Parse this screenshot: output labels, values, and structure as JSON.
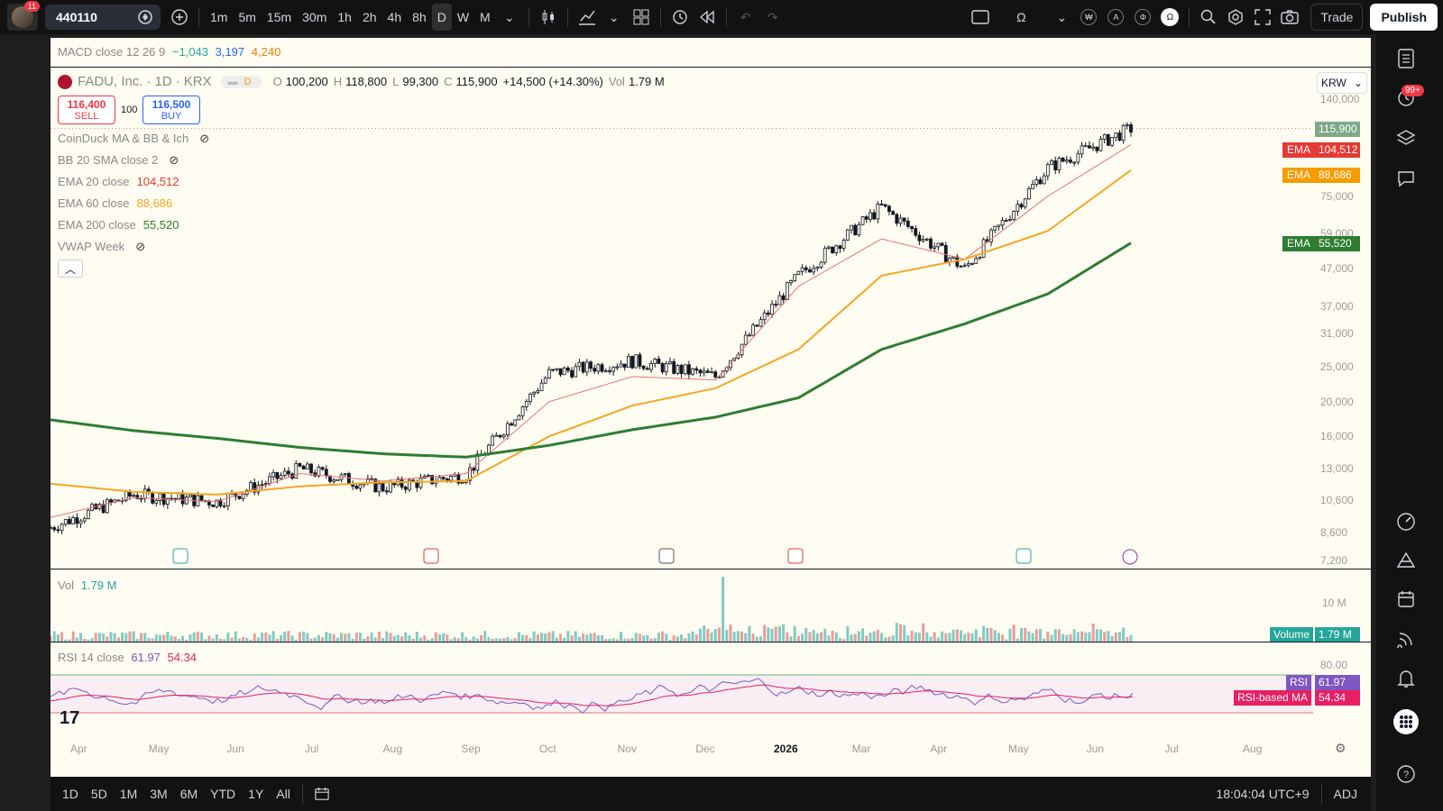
{
  "topbar": {
    "avatar_badge": "11",
    "symbol": "440110",
    "intervals": [
      "1m",
      "5m",
      "15m",
      "30m",
      "1h",
      "2h",
      "4h",
      "8h",
      "D",
      "W",
      "M"
    ],
    "active_interval": "D",
    "trade_label": "Trade",
    "publish_label": "Publish"
  },
  "macd": {
    "label": "MACD close 12 26 9",
    "v1": "−1,043",
    "v2": "3,197",
    "v3": "4,240"
  },
  "symbol_info": {
    "name": "FADU, Inc.",
    "interval": "1D",
    "exchange": "KRX",
    "flag": "D",
    "open_label": "O",
    "open": "100,200",
    "high_label": "H",
    "high": "118,800",
    "low_label": "L",
    "low": "99,300",
    "close_label": "C",
    "close": "115,900",
    "change": "+14,500 (+14.30%)",
    "vol_label": "Vol",
    "vol": "1.79 M"
  },
  "order": {
    "sell_price": "116,400",
    "sell_label": "SELL",
    "qty": "100",
    "buy_price": "116,500",
    "buy_label": "BUY"
  },
  "currency": "KRW",
  "indicators": [
    {
      "label": "CoinDuck MA & BB & Ich",
      "value": "",
      "color": "#888888",
      "hidden": true
    },
    {
      "label": "BB 20 SMA close 2",
      "value": "",
      "color": "#888888",
      "hidden": true
    },
    {
      "label": "EMA 20 close",
      "value": "104,512",
      "color": "#e53935",
      "hidden": false
    },
    {
      "label": "EMA 60 close",
      "value": "88,686",
      "color": "#f5a623",
      "hidden": false
    },
    {
      "label": "EMA 200 close",
      "value": "55,520",
      "color": "#2e7d32",
      "hidden": false
    },
    {
      "label": "VWAP Week",
      "value": "",
      "color": "#888888",
      "hidden": true
    }
  ],
  "price_axis": [
    "140,000",
    "75,000",
    "59,000",
    "47,000",
    "37,000",
    "31,000",
    "25,000",
    "20,000",
    "16,000",
    "13,000",
    "10,600",
    "8,600",
    "7,200"
  ],
  "price_tags": [
    {
      "label": "",
      "value": "115,900",
      "color": "#7fa88a"
    },
    {
      "label": "EMA",
      "value": "104,512",
      "color": "#e53935"
    },
    {
      "label": "EMA",
      "value": "88,686",
      "color": "#f59d00"
    },
    {
      "label": "EMA",
      "value": "55,520",
      "color": "#2e7d32"
    }
  ],
  "volume": {
    "label": "Vol",
    "value": "1.79 M",
    "axis": "10 M",
    "tag_label": "Volume",
    "tag_value": "1.79 M"
  },
  "rsi": {
    "label": "RSI 14 close",
    "v1": "61.97",
    "v2": "54.34",
    "axis_top": "80.00",
    "tag1_label": "RSI",
    "tag1_value": "61.97",
    "tag2_label": "RSI-based MA",
    "tag2_value": "54.34"
  },
  "time_axis": [
    "Apr",
    "May",
    "Jun",
    "Jul",
    "Aug",
    "Sep",
    "Oct",
    "Nov",
    "Dec",
    "2026",
    "Mar",
    "Apr",
    "May",
    "Jun",
    "Jul",
    "Aug"
  ],
  "bottombar": {
    "ranges": [
      "1D",
      "5D",
      "1M",
      "3M",
      "6M",
      "YTD",
      "1Y",
      "All"
    ],
    "clock": "18:04:04 UTC+9",
    "adj": "ADJ"
  },
  "chart_data": {
    "type": "line",
    "title": "FADU, Inc. · 1D · KRX",
    "log_scale": true,
    "ylim": [
      7200,
      145000
    ],
    "x": [
      "Apr",
      "May",
      "Jun",
      "Jul",
      "Aug",
      "Sep",
      "Oct",
      "Nov",
      "Dec",
      "2026",
      "Mar",
      "Apr",
      "May",
      "Jun"
    ],
    "series": [
      {
        "name": "EMA 20 close",
        "color": "#e57373",
        "values": [
          9500,
          10800,
          10500,
          12600,
          12000,
          12600,
          20000,
          23500,
          23000,
          42000,
          57000,
          50000,
          75000,
          104512
        ]
      },
      {
        "name": "EMA 60 close",
        "color": "#f5a623",
        "values": [
          11800,
          11200,
          11000,
          11600,
          11900,
          12000,
          16000,
          19500,
          21800,
          28000,
          45000,
          50000,
          60000,
          88686
        ]
      },
      {
        "name": "EMA 200 close",
        "color": "#2e7d32",
        "values": [
          17800,
          16600,
          15800,
          14900,
          14300,
          14000,
          15100,
          16700,
          18100,
          20500,
          28000,
          33000,
          40000,
          55520
        ]
      },
      {
        "name": "Close",
        "color": "#131722",
        "values": [
          8900,
          11000,
          10500,
          13000,
          11500,
          12500,
          24000,
          26000,
          23500,
          45000,
          70000,
          47000,
          90000,
          115900
        ]
      }
    ]
  }
}
